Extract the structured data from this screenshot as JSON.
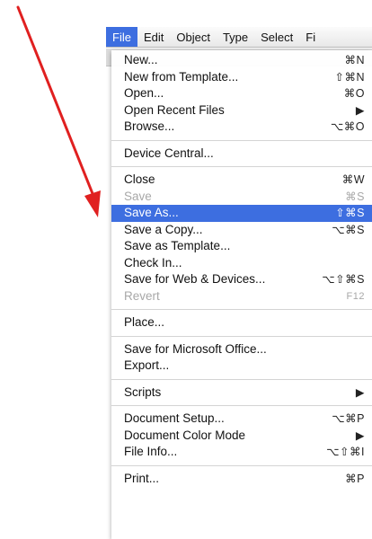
{
  "menubar": {
    "items": [
      "File",
      "Edit",
      "Object",
      "Type",
      "Select",
      "Fi"
    ]
  },
  "menu": {
    "items": [
      {
        "label": "New...",
        "shortcut": "⌘N"
      },
      {
        "label": "New from Template...",
        "shortcut": "⇧⌘N"
      },
      {
        "label": "Open...",
        "shortcut": "⌘O"
      },
      {
        "label": "Open Recent Files",
        "shortcut": "▶"
      },
      {
        "label": "Browse...",
        "shortcut": "⌥⌘O"
      },
      {
        "label": "Device Central...",
        "shortcut": ""
      },
      {
        "label": "Close",
        "shortcut": "⌘W"
      },
      {
        "label": "Save",
        "shortcut": "⌘S"
      },
      {
        "label": "Save As...",
        "shortcut": "⇧⌘S"
      },
      {
        "label": "Save a Copy...",
        "shortcut": "⌥⌘S"
      },
      {
        "label": "Save as Template...",
        "shortcut": ""
      },
      {
        "label": "Check In...",
        "shortcut": ""
      },
      {
        "label": "Save for Web & Devices...",
        "shortcut": "⌥⇧⌘S"
      },
      {
        "label": "Revert",
        "shortcut": "F12"
      },
      {
        "label": "Place...",
        "shortcut": ""
      },
      {
        "label": "Save for Microsoft Office...",
        "shortcut": ""
      },
      {
        "label": "Export...",
        "shortcut": ""
      },
      {
        "label": "Scripts",
        "shortcut": "▶"
      },
      {
        "label": "Document Setup...",
        "shortcut": "⌥⌘P"
      },
      {
        "label": "Document Color Mode",
        "shortcut": "▶"
      },
      {
        "label": "File Info...",
        "shortcut": "⌥⇧⌘I"
      },
      {
        "label": "Print...",
        "shortcut": "⌘P"
      }
    ]
  },
  "colors": {
    "highlight": "#3d6ee0",
    "arrow": "#e02020"
  }
}
